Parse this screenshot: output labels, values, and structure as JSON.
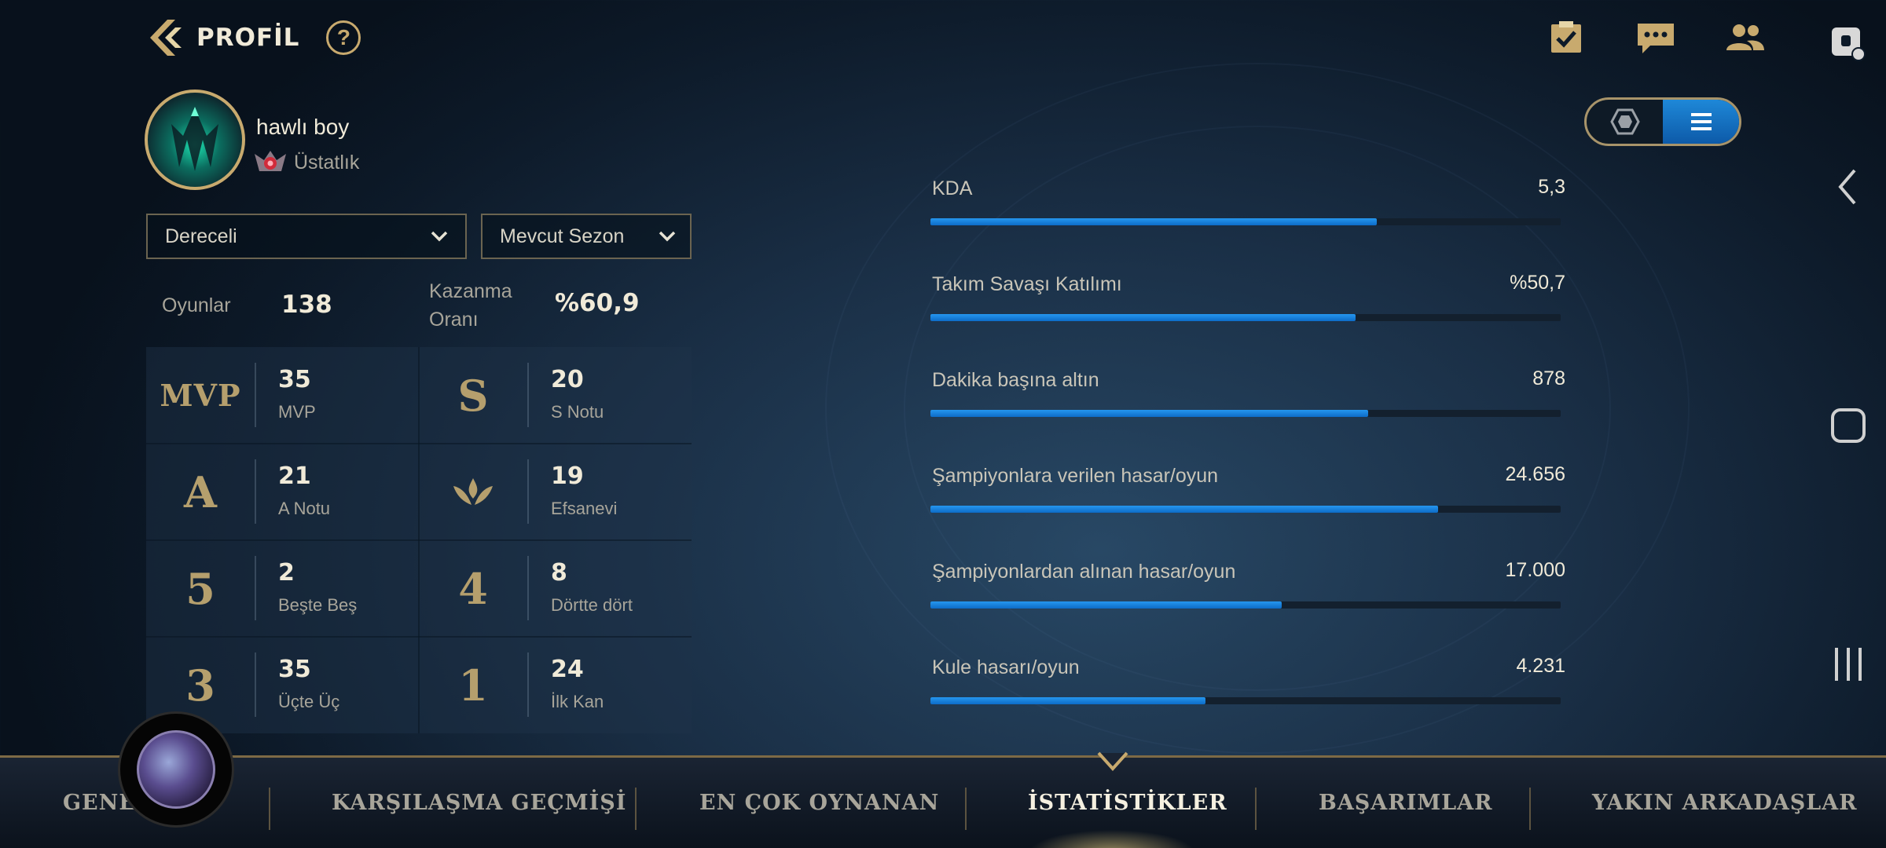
{
  "header": {
    "title": "PROFİL",
    "help": "?"
  },
  "top_icons": [
    "missions-icon",
    "chat-icon",
    "friends-icon"
  ],
  "profile": {
    "username": "hawlı boy",
    "rank": "Üstatlık"
  },
  "filters": {
    "queue": "Dereceli",
    "season": "Mevcut Sezon"
  },
  "summary": {
    "games_label": "Oyunlar",
    "games_value": "138",
    "winrate_label_1": "Kazanma",
    "winrate_label_2": "Oranı",
    "winrate_value": "%60,9"
  },
  "badges": [
    {
      "glyph": "MVP",
      "value": "35",
      "label": "MVP"
    },
    {
      "glyph": "S",
      "value": "20",
      "label": "S Notu"
    },
    {
      "glyph": "A",
      "value": "21",
      "label": "A Notu"
    },
    {
      "glyph": "",
      "value": "19",
      "label": "Efsanevi"
    },
    {
      "glyph": "5",
      "value": "2",
      "label": "Beşte Beş"
    },
    {
      "glyph": "4",
      "value": "8",
      "label": "Dörtte dört"
    },
    {
      "glyph": "3",
      "value": "35",
      "label": "Üçte Üç"
    },
    {
      "glyph": "1",
      "value": "24",
      "label": "İlk Kan"
    }
  ],
  "stats": [
    {
      "label": "KDA",
      "value": "5,3",
      "fill": 0.708
    },
    {
      "label": "Takım Savaşı Katılımı",
      "value": "%50,7",
      "fill": 0.674
    },
    {
      "label": "Dakika başına altın",
      "value": "878",
      "fill": 0.694
    },
    {
      "label": "Şampiyonlara verilen hasar/oyun",
      "value": "24.656",
      "fill": 0.805
    },
    {
      "label": "Şampiyonlardan alınan hasar/oyun",
      "value": "17.000",
      "fill": 0.557
    },
    {
      "label": "Kule hasarı/oyun",
      "value": "4.231",
      "fill": 0.436
    }
  ],
  "tabs": [
    {
      "label": "GENEL"
    },
    {
      "label": "KARŞILAŞMA GEÇMİŞİ"
    },
    {
      "label": "EN ÇOK OYNANAN"
    },
    {
      "label": "İSTATİSTİKLER"
    },
    {
      "label": "BAŞARIMLAR"
    },
    {
      "label": "YAKIN ARKADAŞLAR"
    }
  ],
  "active_tab": "İSTATİSTİKLER",
  "colors": {
    "accent_gold": "#c8aa6e",
    "bar_blue": "#1a84e0",
    "background": "#1a2f46"
  }
}
